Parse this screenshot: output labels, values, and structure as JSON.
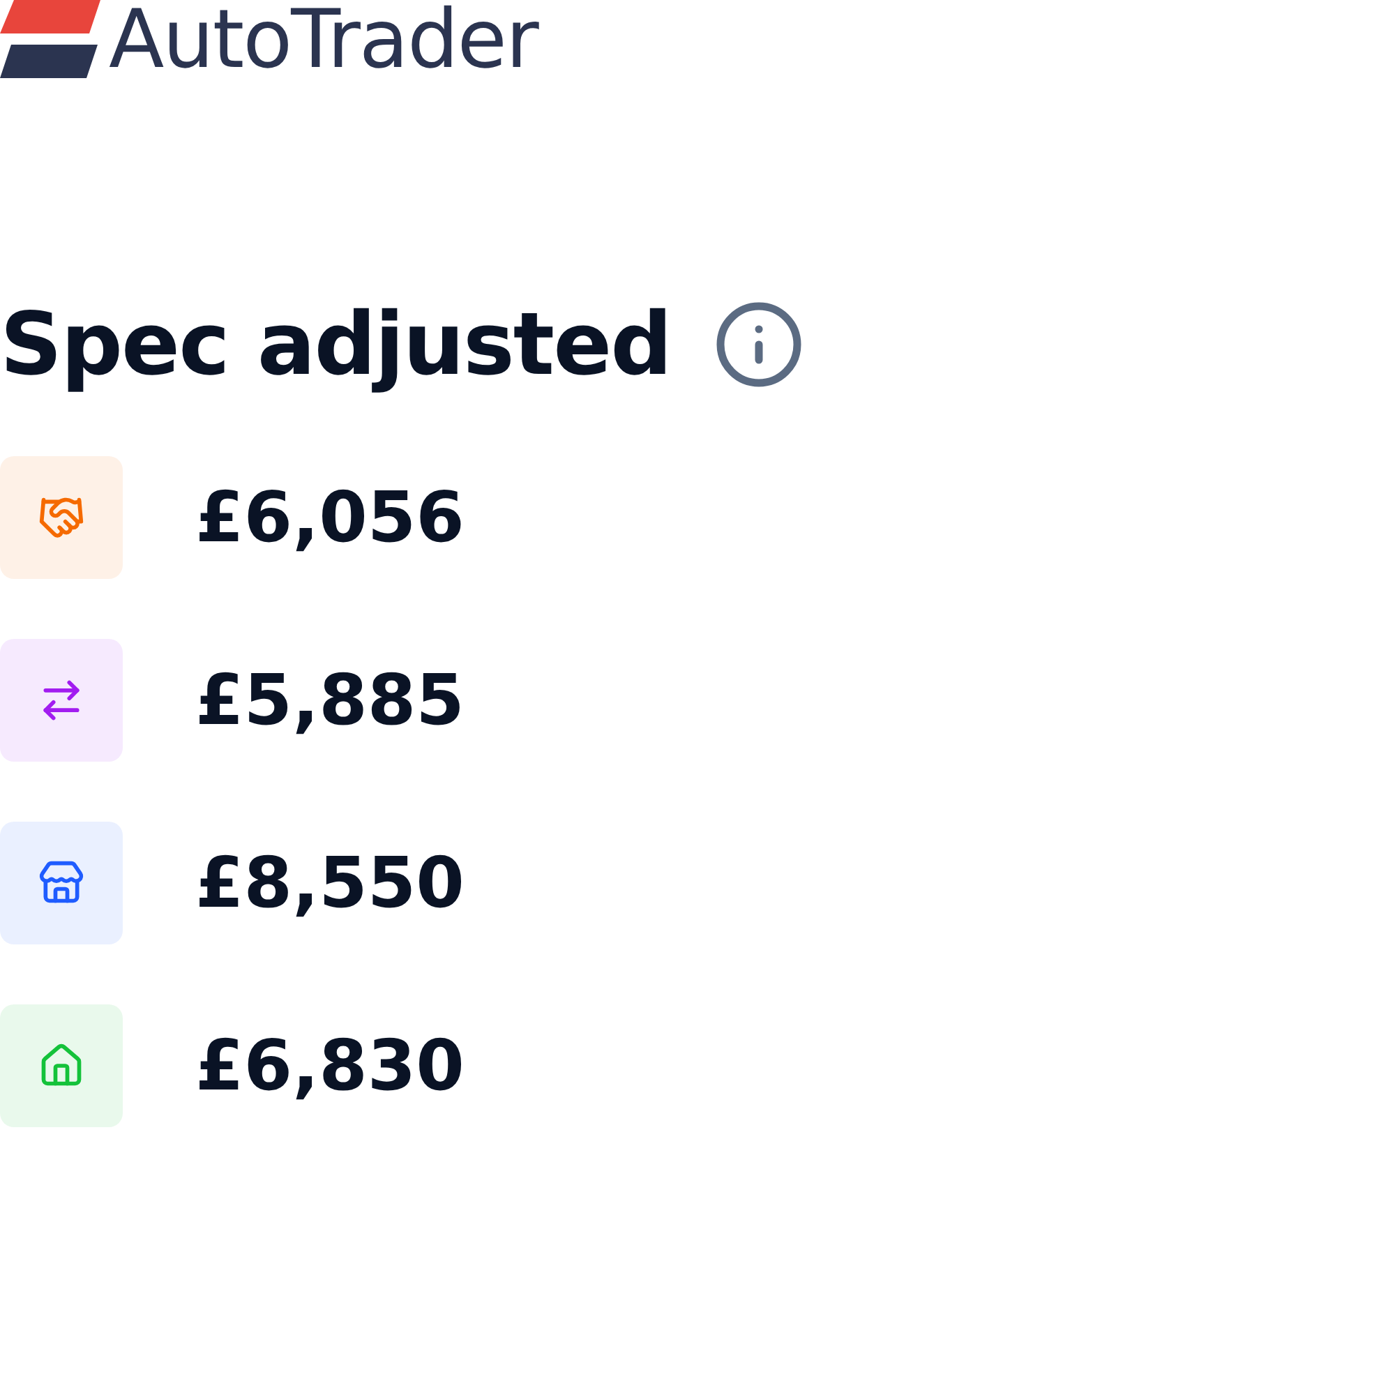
{
  "logo": {
    "text": "AutoTrader"
  },
  "heading": {
    "title": "Spec adjusted"
  },
  "valuations": [
    {
      "kind": "handshake",
      "color": "#f56a00",
      "price": "£6,056"
    },
    {
      "kind": "swap",
      "color": "#a21cf0",
      "price": "£5,885"
    },
    {
      "kind": "store",
      "color": "#1f5cff",
      "price": "£8,550"
    },
    {
      "kind": "home",
      "color": "#14c23a",
      "price": "£6,830"
    }
  ]
}
